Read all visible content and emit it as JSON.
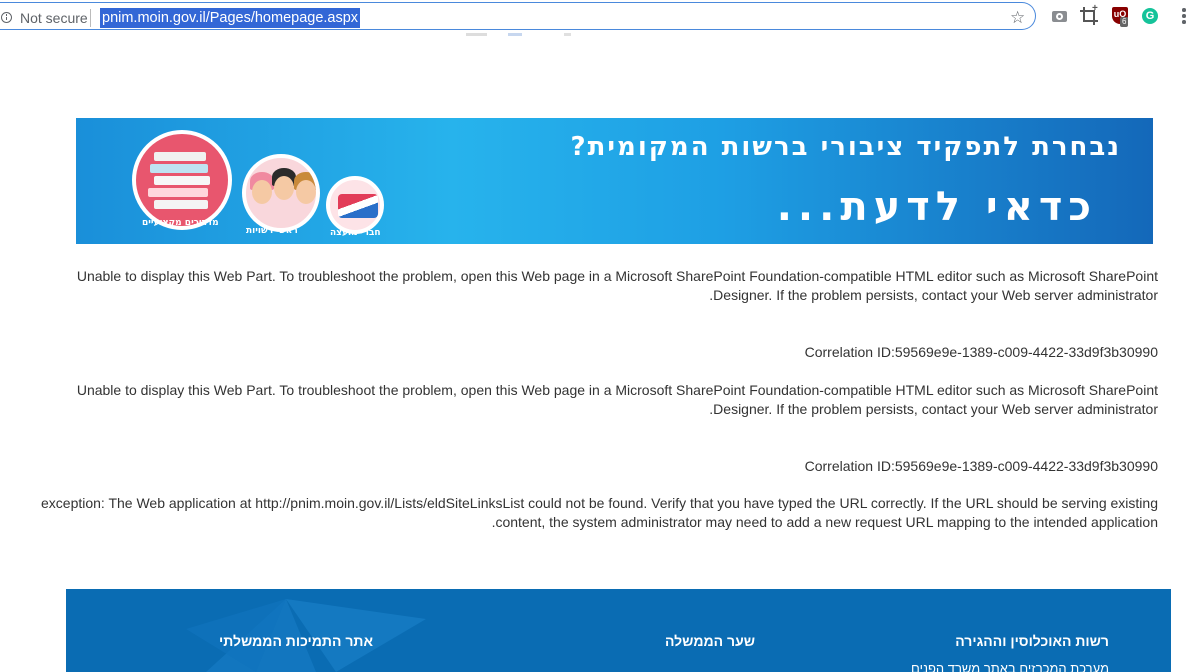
{
  "browser": {
    "security_label": "Not secure",
    "url": "pnim.moin.gov.il/Pages/homepage.aspx",
    "extensions": [
      {
        "name": "camera-icon"
      },
      {
        "name": "crop-icon"
      },
      {
        "name": "ublock-icon",
        "label": "uO",
        "badge": "6"
      },
      {
        "name": "grammarly-icon",
        "label": "G"
      }
    ]
  },
  "banner": {
    "headline": "נבחרת לתפקיד ציבורי ברשות המקומית?",
    "subheadline": "כדאי לדעת...",
    "captions": [
      "מדריכים מקצועיים",
      "ראשי רשויות",
      "חברי מועצה"
    ],
    "colors": {
      "start": "#1a8fd9",
      "end": "#1468b9"
    }
  },
  "messages": [
    {
      "lines": [
        "Unable to display this Web Part. To troubleshoot the problem, open this Web page in a Microsoft SharePoint Foundation-compatible HTML editor such as Microsoft SharePoint",
        "Designer. If the problem persists, contact your Web server administrator."
      ]
    },
    {
      "lines": [
        "Correlation ID:59569e9e-1389-c009-4422-33d9f3b30990"
      ]
    },
    {
      "lines": [
        "Unable to display this Web Part. To troubleshoot the problem, open this Web page in a Microsoft SharePoint Foundation-compatible HTML editor such as Microsoft SharePoint",
        "Designer. If the problem persists, contact your Web server administrator."
      ]
    },
    {
      "lines": [
        "Correlation ID:59569e9e-1389-c009-4422-33d9f3b30990"
      ]
    },
    {
      "lines": [
        "exception: The Web application at http://pnim.moin.gov.il/Lists/eldSiteLinksList could not be found. Verify that you have typed the URL correctly. If the URL should be serving existing",
        "content, the system administrator may need to add a new request URL mapping to the intended application."
      ]
    }
  ],
  "footer": {
    "background": "#0a6cb3",
    "columns": [
      {
        "title": "רשות האוכלוסין וההגירה",
        "sublink": "מערכת המכרזים באתר משרד הפנים"
      },
      {
        "title": "שער הממשלה"
      },
      {
        "title": "אתר התמיכות הממשלתי"
      }
    ]
  }
}
